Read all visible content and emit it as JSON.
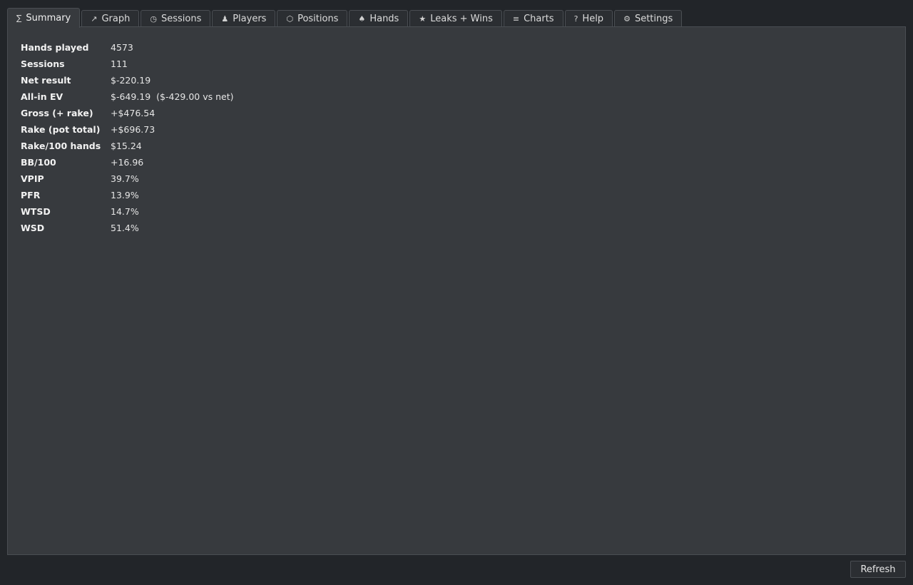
{
  "tabs": [
    {
      "icon": "∑",
      "icon_name": "sigma-icon",
      "label": "Summary",
      "active": true
    },
    {
      "icon": "↗",
      "icon_name": "trend-arrow-icon",
      "label": "Graph"
    },
    {
      "icon": "◷",
      "icon_name": "clock-icon",
      "label": "Sessions"
    },
    {
      "icon": "♟",
      "icon_name": "pawn-icon",
      "label": "Players"
    },
    {
      "icon": "⬡",
      "icon_name": "hexagon-icon",
      "label": "Positions"
    },
    {
      "icon": "♠",
      "icon_name": "spade-icon",
      "label": "Hands"
    },
    {
      "icon": "★",
      "icon_name": "star-icon",
      "label": "Leaks + Wins"
    },
    {
      "icon": "≡",
      "icon_name": "lines-icon",
      "label": "Charts"
    },
    {
      "icon": "?",
      "icon_name": "question-icon",
      "label": "Help"
    },
    {
      "icon": "⚙",
      "icon_name": "gear-icon",
      "label": "Settings"
    }
  ],
  "summary": {
    "rows": [
      {
        "label": "Hands played",
        "value": "4573"
      },
      {
        "label": "Sessions",
        "value": "111"
      },
      {
        "label": "Net result",
        "value": "$-220.19"
      },
      {
        "label": "All-in EV",
        "value": "$-649.19  ($-429.00 vs net)"
      },
      {
        "label": "Gross (+ rake)",
        "value": "+$476.54"
      },
      {
        "label": "Rake (pot total)",
        "value": "+$696.73"
      },
      {
        "label": "Rake/100 hands",
        "value": "$15.24"
      },
      {
        "label": "BB/100",
        "value": "+16.96"
      },
      {
        "label": "VPIP",
        "value": "39.7%"
      },
      {
        "label": "PFR",
        "value": "13.9%"
      },
      {
        "label": "WTSD",
        "value": "14.7%"
      },
      {
        "label": "WSD",
        "value": "51.4%"
      }
    ]
  },
  "footer": {
    "refresh_label": "Refresh"
  },
  "colors": {
    "background": "#222529",
    "panel": "#373a3e",
    "tab": "#2b2e32",
    "border": "#4a4e53"
  }
}
